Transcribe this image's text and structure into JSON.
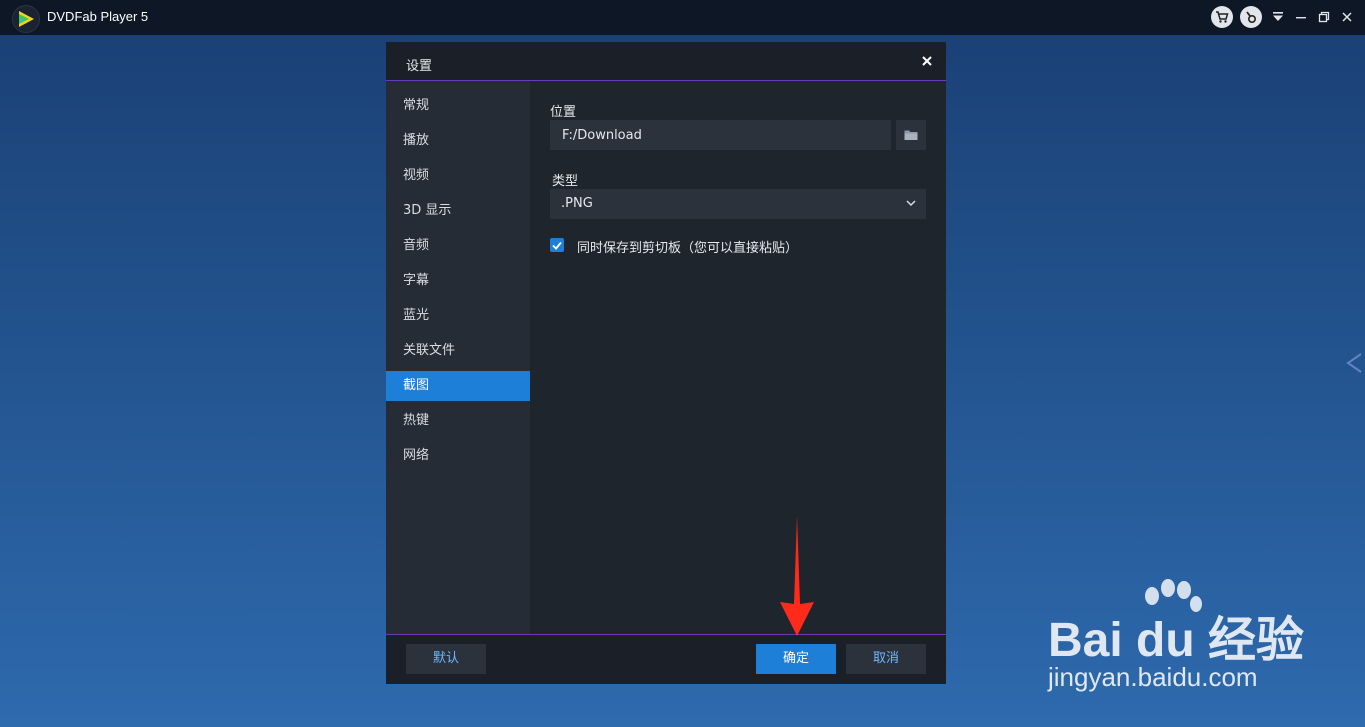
{
  "app": {
    "title": "DVDFab Player 5"
  },
  "dialog": {
    "title": "设置",
    "nav": [
      {
        "label": "常规",
        "active": false
      },
      {
        "label": "播放",
        "active": false
      },
      {
        "label": "视频",
        "active": false
      },
      {
        "label": "3D 显示",
        "active": false
      },
      {
        "label": "音频",
        "active": false
      },
      {
        "label": "字幕",
        "active": false
      },
      {
        "label": "蓝光",
        "active": false
      },
      {
        "label": "关联文件",
        "active": false
      },
      {
        "label": "截图",
        "active": true
      },
      {
        "label": "热键",
        "active": false
      },
      {
        "label": "网络",
        "active": false
      }
    ],
    "location_label": "位置",
    "location_value": "F:/Download",
    "type_label": "类型",
    "type_value": ".PNG",
    "clipboard_label": "同时保存到剪切板（您可以直接粘贴）",
    "clipboard_checked": true,
    "default_btn": "默认",
    "ok_btn": "确定",
    "cancel_btn": "取消"
  },
  "watermark": {
    "brand": "Bai du 经验",
    "url": "jingyan.baidu.com"
  },
  "colors": {
    "accent": "#1e7fd9",
    "annotation": "#ff2a1a"
  },
  "icons": [
    "app-logo-icon",
    "cart-icon",
    "settings-icon",
    "dropdown-icon",
    "minimize-icon",
    "restore-icon",
    "close-icon",
    "folder-icon",
    "chevron-down-icon",
    "check-icon",
    "chevron-left-icon"
  ]
}
